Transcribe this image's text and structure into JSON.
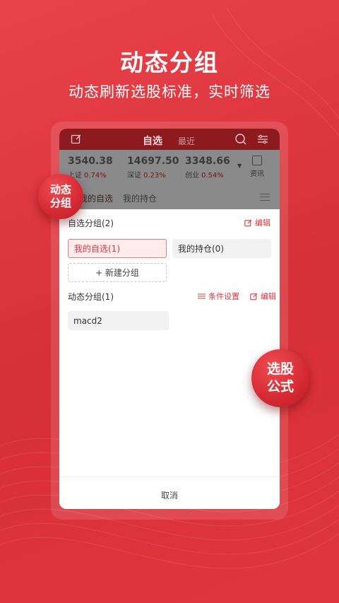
{
  "hero": {
    "title": "动态分组",
    "subtitle": "动态刷新选股标准，实时筛选"
  },
  "app_header": {
    "tab_main": "自选",
    "tab_recent": "最近",
    "icons": [
      "edit-icon",
      "search-icon",
      "filter-icon"
    ]
  },
  "quotes": [
    {
      "value": "3540.38",
      "name": "上证",
      "pct": "0.74%"
    },
    {
      "value": "14697.50",
      "name": "深证",
      "pct": "0.23%"
    },
    {
      "value": "3348.66",
      "name": "创业",
      "pct": "0.54%"
    }
  ],
  "news_label": "资讯",
  "subtabs": [
    "我的自选",
    "我的持仓"
  ],
  "sheet": {
    "custom_group": {
      "title": "自选分组(2)",
      "edit": "编辑",
      "chips": [
        "我的自选(1)",
        "我的持仓(0)"
      ],
      "new_group": "+ 新建分组"
    },
    "dynamic_group": {
      "title": "动态分组(1)",
      "condition": "条件设置",
      "edit": "编辑",
      "chips": [
        "macd2"
      ]
    },
    "cancel": "取消"
  },
  "badges": {
    "left": [
      "动态",
      "分组"
    ],
    "right": [
      "选股",
      "公式"
    ]
  },
  "colors": {
    "brand_red": "#d8373f",
    "header_dark_red": "#8d1a1f",
    "background_red": "#e0363f"
  }
}
